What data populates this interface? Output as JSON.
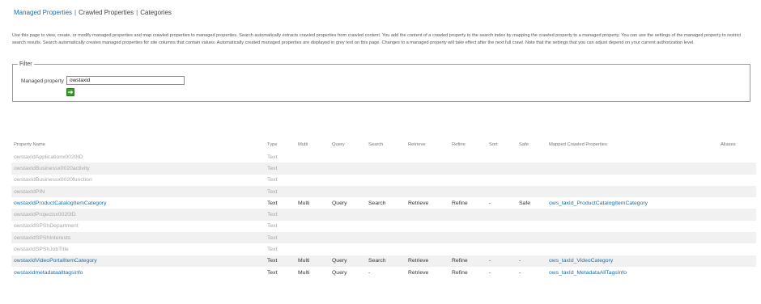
{
  "nav": {
    "managed_properties": "Managed Properties",
    "crawled_properties": "Crawled Properties",
    "categories": "Categories",
    "separator": "|"
  },
  "description": "Use this page to view, create, or modify managed properties and map crawled properties to managed properties. Search automatically extracts crawled properties from crawled content. You add the content of a crawled property to the search index by mapping the crawled property to a managed property. You can use the settings of the managed property to restrict search results. Search automatically creates managed properties for site columns that contain values. Automatically created managed properties are displayed in grey text on this page. Changes to a managed property will take effect after the next full crawl. Note that the settings that you can adjust depend on your current authorization level.",
  "filter": {
    "legend": "Filter",
    "label": "Managed property",
    "value": "owstaxid",
    "go_icon": "arrow-right-icon",
    "go_color": "#3a9a2b"
  },
  "table": {
    "headers": {
      "name": "Property Name",
      "type": "Type",
      "multi": "Multi",
      "query": "Query",
      "search": "Search",
      "retrieve": "Retrieve",
      "refine": "Refine",
      "sort": "Sort",
      "safe": "Safe",
      "mapped": "Mapped Crawled Properties",
      "aliases": "Aliases"
    },
    "rows": [
      {
        "name": "owstaxIdApplicationx0020ID",
        "type": "Text",
        "multi": "",
        "query": "",
        "search": "",
        "retrieve": "",
        "refine": "",
        "sort": "",
        "safe": "",
        "mapped": "",
        "aliases": ""
      },
      {
        "name": "owstaxIdBusinessx0020activity",
        "type": "Text",
        "multi": "",
        "query": "",
        "search": "",
        "retrieve": "",
        "refine": "",
        "sort": "",
        "safe": "",
        "mapped": "",
        "aliases": ""
      },
      {
        "name": "owstaxIdBusinessx0020function",
        "type": "Text",
        "multi": "",
        "query": "",
        "search": "",
        "retrieve": "",
        "refine": "",
        "sort": "",
        "safe": "",
        "mapped": "",
        "aliases": ""
      },
      {
        "name": "owstaxIdPIN",
        "type": "Text",
        "multi": "",
        "query": "",
        "search": "",
        "retrieve": "",
        "refine": "",
        "sort": "",
        "safe": "",
        "mapped": "",
        "aliases": ""
      },
      {
        "name": "owstaxIdProductCatalogItemCategory",
        "type": "Text",
        "multi": "Multi",
        "query": "Query",
        "search": "Search",
        "retrieve": "Retrieve",
        "refine": "Refine",
        "sort": "-",
        "safe": "Safe",
        "mapped": "ows_taxId_ProductCatalogItemCategory",
        "aliases": ""
      },
      {
        "name": "owstaxIdProjectsx0020ID",
        "type": "Text",
        "multi": "",
        "query": "",
        "search": "",
        "retrieve": "",
        "refine": "",
        "sort": "",
        "safe": "",
        "mapped": "",
        "aliases": ""
      },
      {
        "name": "owstaxIdSPShDepartment",
        "type": "Text",
        "multi": "",
        "query": "",
        "search": "",
        "retrieve": "",
        "refine": "",
        "sort": "",
        "safe": "",
        "mapped": "",
        "aliases": ""
      },
      {
        "name": "owstaxIdSPShInterests",
        "type": "Text",
        "multi": "",
        "query": "",
        "search": "",
        "retrieve": "",
        "refine": "",
        "sort": "",
        "safe": "",
        "mapped": "",
        "aliases": ""
      },
      {
        "name": "owstaxIdSPShJobTitle",
        "type": "Text",
        "multi": "",
        "query": "",
        "search": "",
        "retrieve": "",
        "refine": "",
        "sort": "",
        "safe": "",
        "mapped": "",
        "aliases": ""
      },
      {
        "name": "owstaxIdVideoPortalItemCategory",
        "type": "Text",
        "multi": "Multi",
        "query": "Query",
        "search": "Search",
        "retrieve": "Retrieve",
        "refine": "Refine",
        "sort": "-",
        "safe": "-",
        "mapped": "ows_taxId_VideoCategory",
        "aliases": ""
      },
      {
        "name": "owstaxidmetadataalltagsinfo",
        "type": "Text",
        "multi": "Multi",
        "query": "Query",
        "search": "-",
        "retrieve": "Retrieve",
        "refine": "Refine",
        "sort": "-",
        "safe": "-",
        "mapped": "ows_taxId_MetadataAllTagsInfo",
        "aliases": ""
      }
    ]
  },
  "colors": {
    "link": "#1e6fa5",
    "auto_created_text": "#a6a6a6",
    "alt_row": "#f1f1f1"
  }
}
